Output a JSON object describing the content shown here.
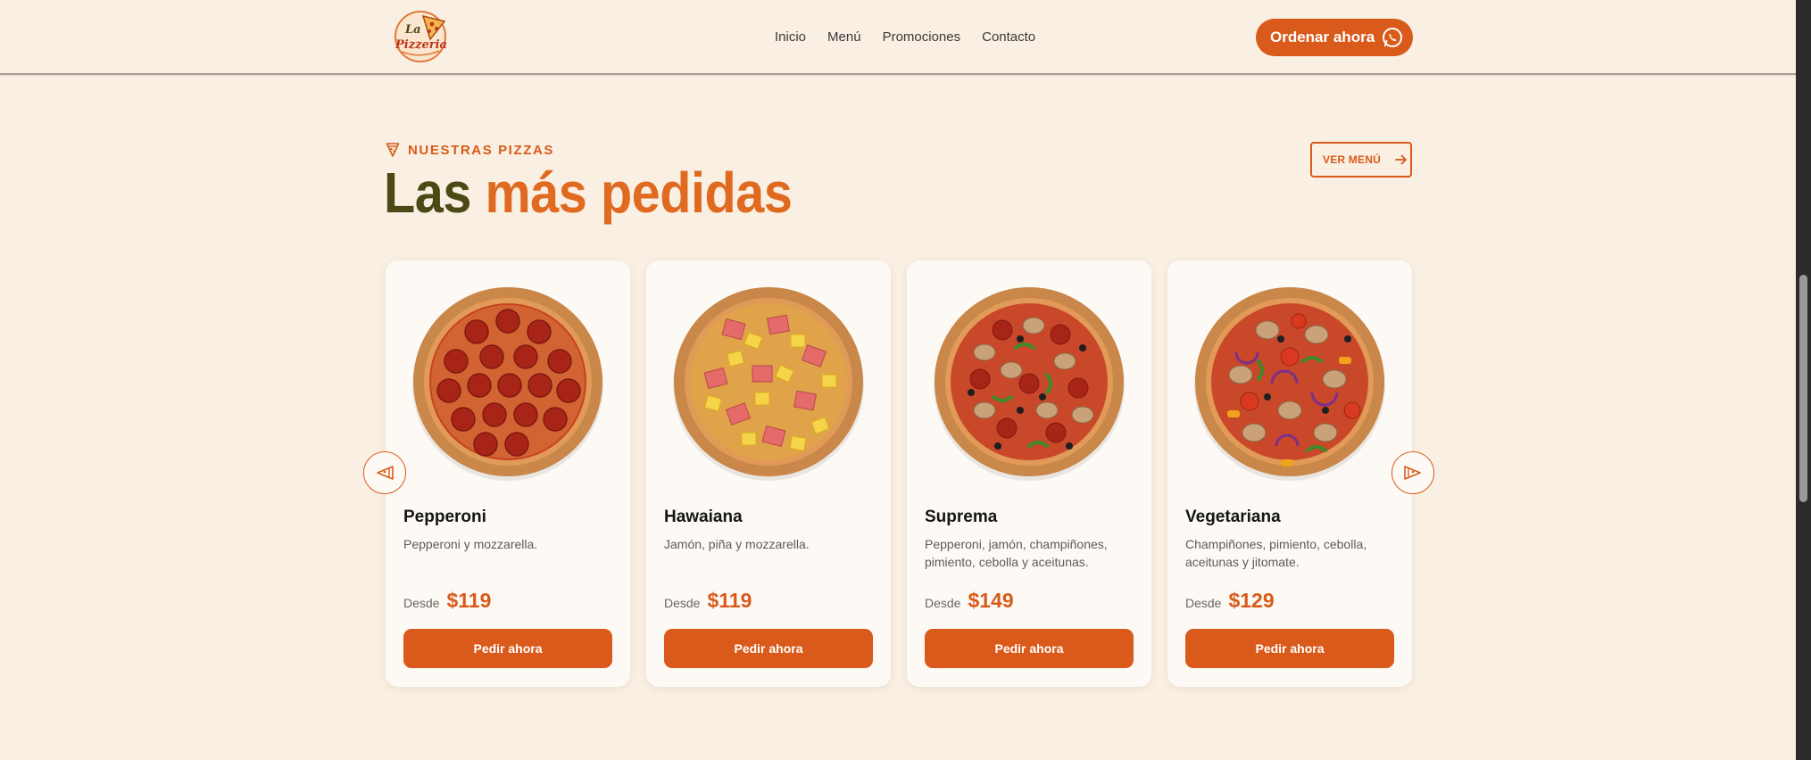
{
  "header": {
    "logo_text_top": "La",
    "logo_text_bottom": "Pizzeria",
    "nav": [
      "Inicio",
      "Menú",
      "Promociones",
      "Contacto"
    ],
    "order_button": "Ordenar ahora"
  },
  "section": {
    "eyebrow": "NUESTRAS PIZZAS",
    "title_part1": "Las",
    "title_part2": "más pedidas",
    "view_menu": "VER MENÚ"
  },
  "cards": [
    {
      "name": "Pepperoni",
      "description": "Pepperoni y mozzarella.",
      "price_label": "Desde",
      "price": "$119",
      "cta": "Pedir ahora"
    },
    {
      "name": "Hawaiana",
      "description": "Jamón, piña y mozzarella.",
      "price_label": "Desde",
      "price": "$119",
      "cta": "Pedir ahora"
    },
    {
      "name": "Suprema",
      "description": "Pepperoni, jamón, champiñones, pimiento, cebolla y aceitunas.",
      "price_label": "Desde",
      "price": "$149",
      "cta": "Pedir ahora"
    },
    {
      "name": "Vegetariana",
      "description": "Champiñones, pimiento, cebolla, aceitunas y jitomate.",
      "price_label": "Desde",
      "price": "$129",
      "cta": "Pedir ahora"
    }
  ],
  "colors": {
    "accent": "#d95a1a",
    "background": "#f9efe2",
    "title_dark": "#4b4a14"
  },
  "icons": {
    "carousel_prev": "pizza-slice-left-icon",
    "carousel_next": "pizza-slice-right-icon",
    "order": "whatsapp-icon",
    "menu_link": "arrow-right-icon",
    "eyebrow": "pizza-slice-icon"
  }
}
